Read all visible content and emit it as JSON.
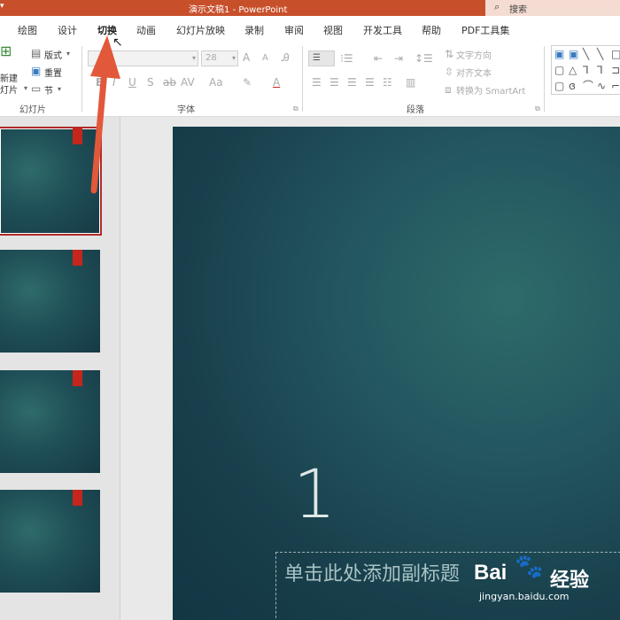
{
  "window": {
    "title": "演示文稿1  -  PowerPoint",
    "search_label": "搜索",
    "search_icon": "search-icon",
    "title_color": "#c7502b"
  },
  "tabs": [
    {
      "label": "绘图"
    },
    {
      "label": "设计"
    },
    {
      "label": "切换",
      "active": true
    },
    {
      "label": "动画"
    },
    {
      "label": "幻灯片放映"
    },
    {
      "label": "录制"
    },
    {
      "label": "审阅"
    },
    {
      "label": "视图"
    },
    {
      "label": "开发工具"
    },
    {
      "label": "帮助"
    },
    {
      "label": "PDF工具集"
    }
  ],
  "ribbon": {
    "slides_group": {
      "label": "幻灯片",
      "new_slide_line1": "新建",
      "new_slide_line2": "灯片",
      "layout": "版式",
      "reset": "重置",
      "section": "节"
    },
    "font_group": {
      "label": "字体",
      "font_size": "28",
      "grow_font": "A",
      "shrink_font": "A"
    },
    "paragraph_group": {
      "label": "段落",
      "text_direction": "文字方向",
      "align_text": "对齐文本",
      "convert_smartart": "转换为 SmartArt"
    }
  },
  "slide": {
    "number": "1",
    "subtitle_placeholder": "单击此处添加副标题"
  },
  "watermark": {
    "brand": "Bai",
    "name": "经验",
    "url": "jingyan.baidu.com"
  },
  "colors": {
    "accent_red": "#c4261c",
    "annotation_arrow": "#e2583a",
    "slide_bg": "#1f4f57"
  }
}
